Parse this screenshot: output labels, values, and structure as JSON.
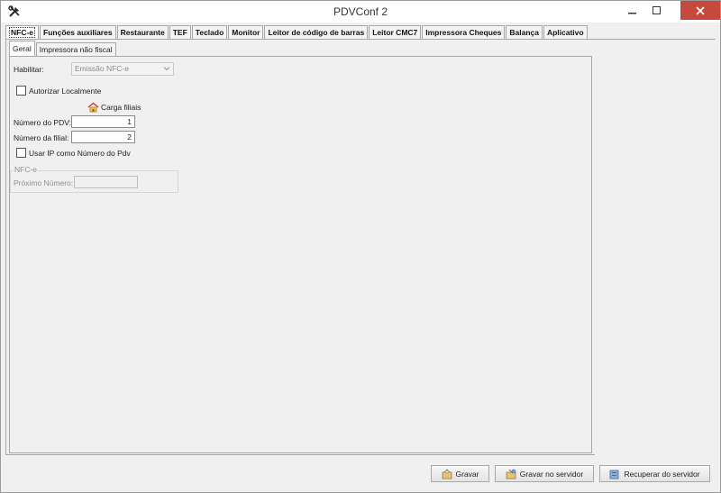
{
  "window": {
    "title": "PDVConf 2"
  },
  "tabs": [
    {
      "label": "NFC-e",
      "active": true
    },
    {
      "label": "Funções auxiliares"
    },
    {
      "label": "Restaurante"
    },
    {
      "label": "TEF"
    },
    {
      "label": "Teclado"
    },
    {
      "label": "Monitor"
    },
    {
      "label": "Leitor de código de barras"
    },
    {
      "label": "Leitor CMC7"
    },
    {
      "label": "Impressora Cheques"
    },
    {
      "label": "Balança"
    },
    {
      "label": "Aplicativo"
    }
  ],
  "subtabs": [
    {
      "label": "Geral",
      "active": true
    },
    {
      "label": "Impressora não fiscal"
    }
  ],
  "form": {
    "habilitar_label": "Habilitar:",
    "habilitar_value": "Emissão NFC-e",
    "autorizar_label": "Autorizar Localmente",
    "autorizar_checked": false,
    "carga_label": "Carga filiais",
    "numero_pdv_label": "Número do PDV:",
    "numero_pdv_value": "1",
    "numero_filial_label": "Número da filial:",
    "numero_filial_value": "2",
    "usar_ip_label": "Usar IP como Número do Pdv",
    "usar_ip_checked": false,
    "group_title": "NFC-e",
    "proximo_label": "Próximo Número:",
    "proximo_value": ""
  },
  "buttons": {
    "gravar": "Gravar",
    "gravar_servidor": "Gravar no servidor",
    "recuperar_servidor": "Recuperar do servidor"
  },
  "icons": {
    "app": "tools-icon",
    "carga": "house-icon",
    "gravar": "save-icon",
    "gravar_servidor": "server-save-icon",
    "recuperar_servidor": "server-load-icon"
  },
  "colors": {
    "close_button": "#c7483c",
    "window_bg": "#f0f0f0"
  }
}
